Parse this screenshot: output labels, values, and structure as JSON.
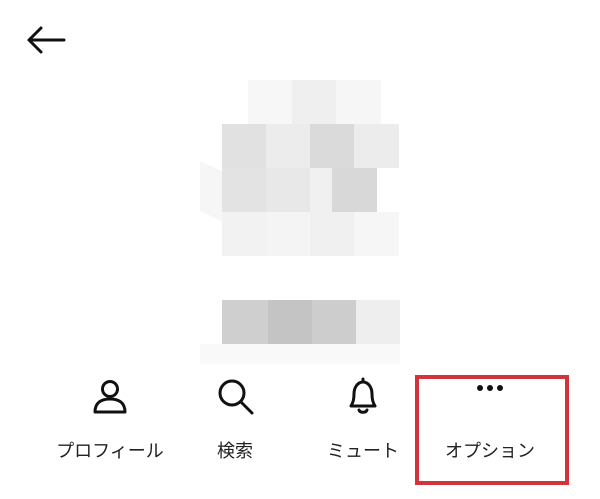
{
  "header": {
    "back_icon": "arrow-left-icon"
  },
  "profile": {
    "avatar_blurred": true,
    "name_blurred": true
  },
  "actions": [
    {
      "label": "プロフィール",
      "icon": "person-icon"
    },
    {
      "label": "検索",
      "icon": "search-icon"
    },
    {
      "label": "ミュート",
      "icon": "bell-icon"
    },
    {
      "label": "オプション",
      "icon": "more-horizontal-icon"
    }
  ],
  "highlight": {
    "target": "オプション",
    "color": "#d3333b"
  }
}
